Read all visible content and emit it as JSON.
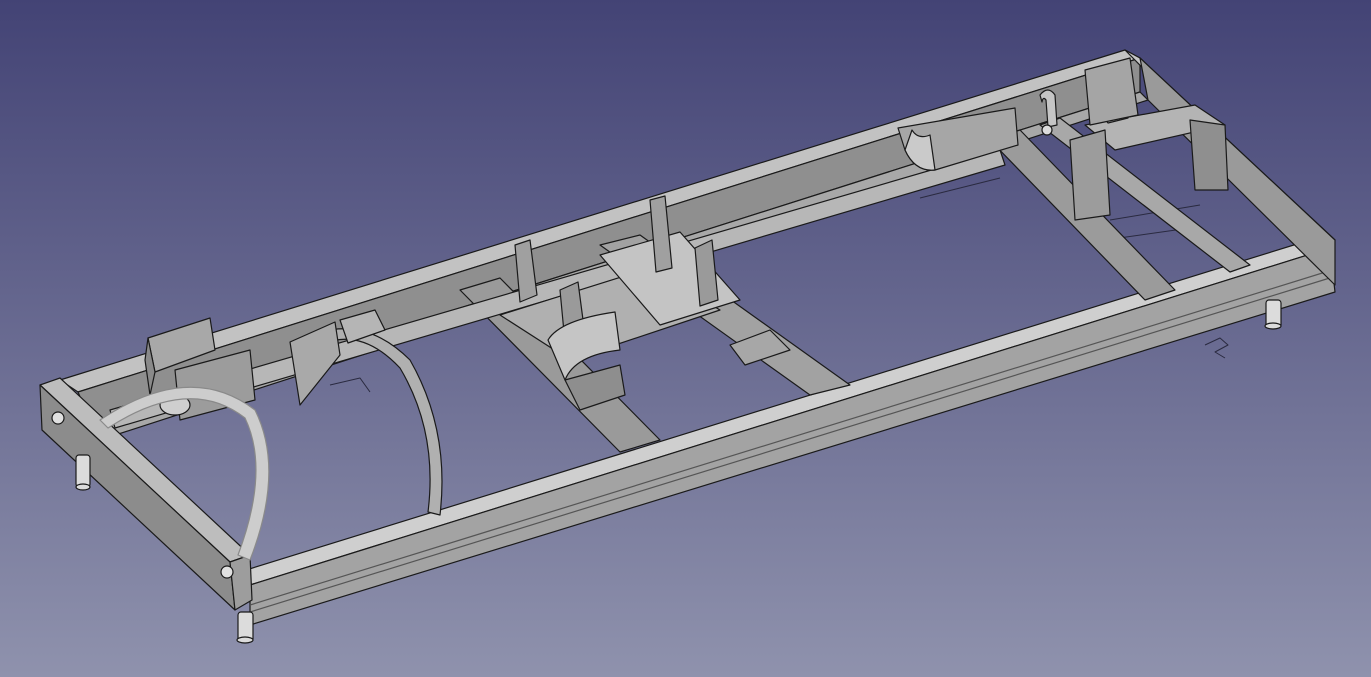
{
  "viewport": {
    "name": "3D view",
    "background_top": "#434375",
    "background_bottom": "#8f92ad"
  },
  "model": {
    "description_icon": "chassis-frame-model",
    "face_color": "#a5a5a5",
    "face_light": "#c9c9c9",
    "face_mid": "#9b9b9b",
    "face_dark": "#7a7a7a",
    "edge_color": "#1a1a1a"
  }
}
